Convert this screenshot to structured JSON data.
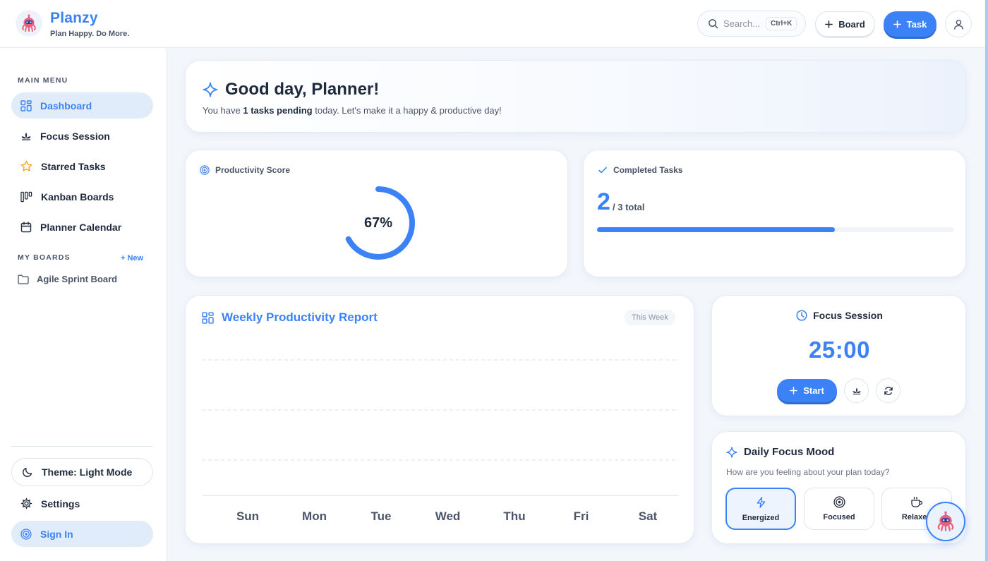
{
  "brand": {
    "name": "Planzy",
    "tagline": "Plan Happy. Do More.",
    "logo_icon": "robot-mascot-icon"
  },
  "header": {
    "search_placeholder": "Search...",
    "search_shortcut": "Ctrl+K",
    "board_button": "Board",
    "task_button": "Task"
  },
  "sidebar": {
    "main_menu_label": "MAIN MENU",
    "items": [
      {
        "label": "Dashboard",
        "icon": "grid-icon",
        "active": true
      },
      {
        "label": "Focus Session",
        "icon": "lotus-icon"
      },
      {
        "label": "Starred Tasks",
        "icon": "star-icon"
      },
      {
        "label": "Kanban Boards",
        "icon": "kanban-icon"
      },
      {
        "label": "Planner Calendar",
        "icon": "calendar-icon"
      }
    ],
    "boards_label": "MY BOARDS",
    "new_board_link": "+ New",
    "boards": [
      {
        "label": "Agile Sprint Board",
        "icon": "folder-icon"
      }
    ],
    "theme_button": "Theme: Light Mode",
    "settings": "Settings",
    "sign_in": "Sign In"
  },
  "welcome": {
    "title": "Good day, Planner!",
    "sub_prefix": "You have ",
    "sub_bold": "1 tasks pending",
    "sub_suffix": " today. Let's make it a happy & productive day!"
  },
  "productivity": {
    "label": "Productivity Score",
    "value_text": "67%",
    "value": 0.67
  },
  "completed": {
    "label": "Completed Tasks",
    "done": "2",
    "total_text": "/ 3 total",
    "fraction": 0.6667
  },
  "weekly": {
    "title": "Weekly Productivity Report",
    "badge": "This Week"
  },
  "chart_data": {
    "type": "bar",
    "categories": [
      "Sun",
      "Mon",
      "Tue",
      "Wed",
      "Thu",
      "Fri",
      "Sat"
    ],
    "values": [
      0,
      0,
      0,
      0,
      0,
      0,
      0
    ],
    "title": "Weekly Productivity Report",
    "grid": true
  },
  "focus": {
    "title": "Focus Session",
    "timer": "25:00",
    "start": "Start"
  },
  "mood": {
    "title": "Daily Focus Mood",
    "subtitle": "How are you feeling about your plan today?",
    "options": [
      {
        "label": "Energized",
        "icon": "lightning-icon",
        "selected": true
      },
      {
        "label": "Focused",
        "icon": "target-icon"
      },
      {
        "label": "Relaxed",
        "icon": "coffee-icon"
      }
    ]
  },
  "colors": {
    "accent": "#3b82f6",
    "text": "#1f2a3d",
    "muted": "#4b5568"
  }
}
